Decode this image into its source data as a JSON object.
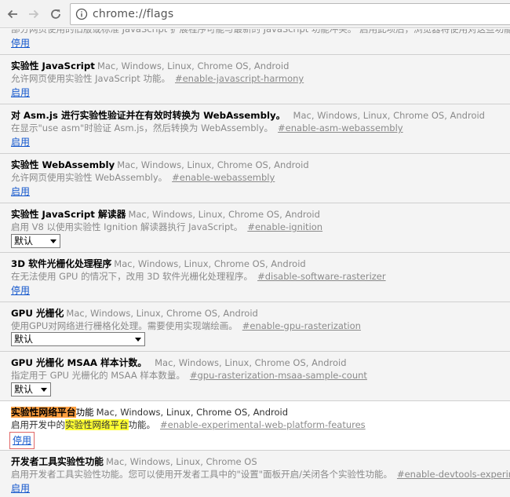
{
  "browser": {
    "url": "chrome://flags",
    "back_label": "←",
    "forward_label": "→",
    "reload_label": "⟳",
    "info_label": "i"
  },
  "flags": {
    "clipped_desc": "部分网页使用的旧版或标准 JavaScript 扩展程序可能与最新的 JavaScript 功能冲突。 启用此项后，浏览器将使用对这些功能的...",
    "clipped_action": "停用",
    "items": [
      {
        "name": "实验性 JavaScript",
        "platforms": "Mac, Windows, Linux, Chrome OS, Android",
        "description": "允许网页使用实验性 JavaScript 功能。",
        "permalink": "#enable-javascript-harmony",
        "action": "启用"
      },
      {
        "name": "对 Asm.js 进行实验性验证并在有效时转换为 WebAssembly。",
        "platforms": "Mac, Windows, Linux, Chrome OS, Android",
        "description": "在显示\"use asm\"时验证 Asm.js，然后转换为 WebAssembly。",
        "permalink": "#enable-asm-webassembly",
        "action": "启用"
      },
      {
        "name": "实验性 WebAssembly",
        "platforms": "Mac, Windows, Linux, Chrome OS, Android",
        "description": "允许网页使用实验性 WebAssembly。",
        "permalink": "#enable-webassembly",
        "action": "启用"
      },
      {
        "name": "实验性 JavaScript 解读器",
        "platforms": "Mac, Windows, Linux, Chrome OS, Android",
        "description": "启用 V8 以使用实验性 Ignition 解读器执行 JavaScript。",
        "permalink": "#enable-ignition",
        "select_value": "默认"
      },
      {
        "name": "3D 软件光栅化处理程序",
        "platforms": "Mac, Windows, Linux, Chrome OS, Android",
        "description": "在无法使用 GPU 的情况下，改用 3D 软件光栅化处理程序。",
        "permalink": "#disable-software-rasterizer",
        "action": "停用"
      },
      {
        "name": "GPU 光栅化",
        "platforms": "Mac, Windows, Linux, Chrome OS, Android",
        "description": "使用GPU对网络进行栅格化处理。需要使用实现端绘画。",
        "permalink": "#enable-gpu-rasterization",
        "select_value": "默认"
      },
      {
        "name": "GPU 光栅化 MSAA 样本计数。",
        "platforms": "Mac, Windows, Linux, Chrome OS, Android",
        "description": "指定用于 GPU 光栅化的 MSAA 样本数量。",
        "permalink": "#gpu-rasterization-msaa-sample-count",
        "select_value": "默认"
      },
      {
        "name_highlight": "实验性网络平台",
        "name_rest": "功能",
        "platforms": "Mac, Windows, Linux, Chrome OS, Android",
        "description_pre": "启用开发中的",
        "description_highlight": "实验性网络平台",
        "description_post": "功能。",
        "permalink": "#enable-experimental-web-platform-features",
        "action": "停用"
      },
      {
        "name": "开发者工具实验性功能",
        "platforms": "Mac, Windows, Linux, Chrome OS",
        "description": "启用开发者工具实验性功能。您可以使用开发者工具中的\"设置\"面板开启/关闭各个实验性功能。",
        "permalink": "#enable-devtools-experiments",
        "action": "启用"
      }
    ]
  },
  "colors": {
    "link": "#1155cc",
    "highlight_orange": "#ff9f3f",
    "highlight_yellow": "#ffff33",
    "focus_box": "#e06666"
  }
}
